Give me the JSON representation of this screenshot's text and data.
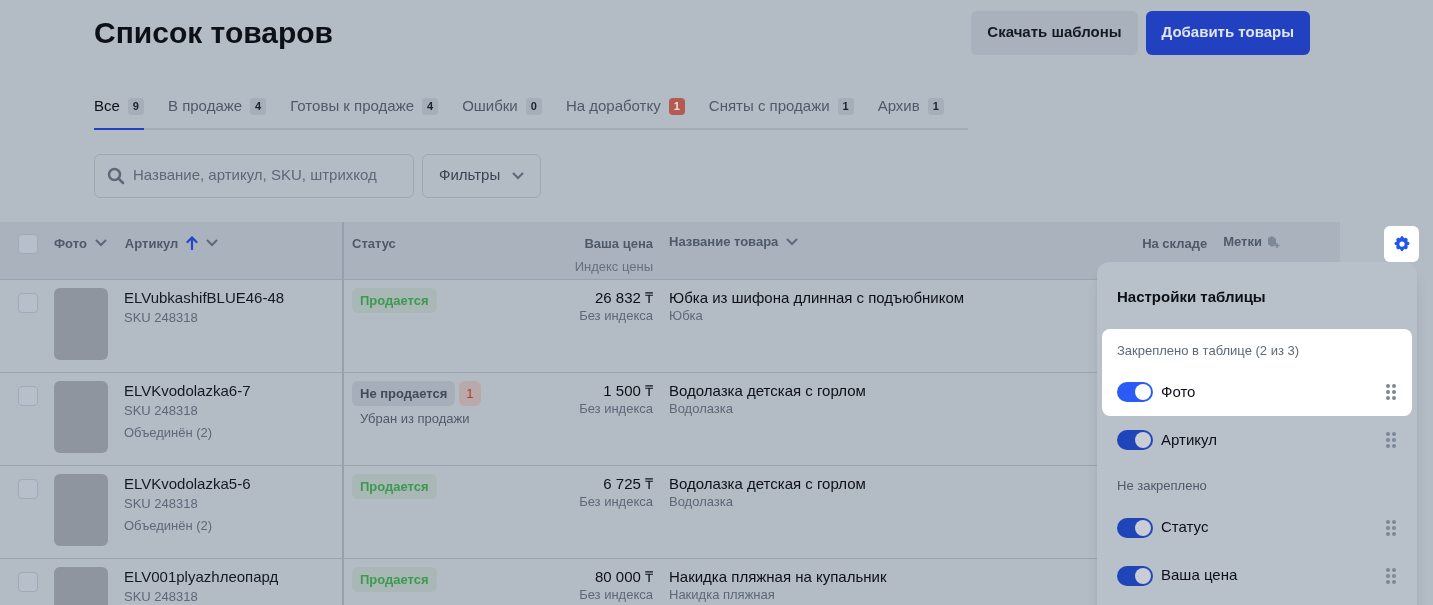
{
  "title": "Список товаров",
  "buttons": [
    {
      "label": "Скачать шаблоны",
      "kind": "secondary"
    },
    {
      "label": "Добавить товары",
      "kind": "primary"
    }
  ],
  "tabs": [
    {
      "label": "Все",
      "count": "9",
      "selected": true,
      "alert": false
    },
    {
      "label": "В продаже",
      "count": "4",
      "selected": false,
      "alert": false
    },
    {
      "label": "Готовы к продаже",
      "count": "4",
      "selected": false,
      "alert": false
    },
    {
      "label": "Ошибки",
      "count": "0",
      "selected": false,
      "alert": false
    },
    {
      "label": "На доработку",
      "count": "1",
      "selected": false,
      "alert": true
    },
    {
      "label": "Сняты с продажи",
      "count": "1",
      "selected": false,
      "alert": false
    },
    {
      "label": "Архив",
      "count": "1",
      "selected": false,
      "alert": false
    }
  ],
  "search": {
    "placeholder": "Название, артикул, SKU, штрихкод"
  },
  "filters": {
    "label": "Фильтры"
  },
  "table": {
    "select_all": {
      "checked": false
    },
    "columns": {
      "photo": "Фото",
      "article": "Артикул",
      "article_sorted": true,
      "status": "Статус",
      "price": "Ваша цена",
      "price_sub": "Индекс цены",
      "name": "Название товара",
      "stock": "На складе",
      "tags": "Метки"
    },
    "rows": [
      {
        "checked": false,
        "article": "ELVubkashifBLUE46-48",
        "sku": "SKU 248318",
        "status": {
          "text": "Продается",
          "kind": "selling"
        },
        "price": "26 832 ₸",
        "price_index": "Без индекса",
        "name": "Юбка из шифона длинная с подъюбником",
        "category": "Юбка"
      },
      {
        "checked": false,
        "article": "ELVKvodolazka6-7",
        "sku": "SKU 248318",
        "merged": "Объединён (2)",
        "status": {
          "text": "Не продается",
          "kind": "not_selling",
          "badge": "1",
          "note": "Убран из продажи"
        },
        "price": "1 500 ₸",
        "price_index": "Без индекса",
        "name": "Водолазка детская с горлом",
        "category": "Водолазка"
      },
      {
        "checked": false,
        "article": "ELVKvodolazka5-6",
        "sku": "SKU 248318",
        "merged": "Объединён (2)",
        "status": {
          "text": "Продается",
          "kind": "selling"
        },
        "price": "6 725 ₸",
        "price_index": "Без индекса",
        "name": "Водолазка детская с горлом",
        "category": "Водолазка"
      },
      {
        "checked": false,
        "article": "ELV001plyazhлеопард",
        "sku": "SKU 248318",
        "status": {
          "text": "Продается",
          "kind": "selling"
        },
        "price": "80 000 ₸",
        "price_index": "Без индекса",
        "name": "Накидка пляжная на купальник",
        "category": "Накидка пляжная"
      }
    ]
  },
  "settings": {
    "gear_highlighted": true,
    "title": "Настройки таблицы",
    "rows": [
      {
        "kind": "heading",
        "text": "Закреплено в таблице (2 из 3)",
        "highlighted": true
      },
      {
        "kind": "toggle",
        "label": "Фото",
        "on": true,
        "highlighted": true
      },
      {
        "kind": "toggle",
        "label": "Артикул",
        "on": true,
        "highlighted": false
      },
      {
        "kind": "heading",
        "text": "Не закреплено",
        "highlighted": false
      },
      {
        "kind": "toggle",
        "label": "Статус",
        "on": true,
        "highlighted": false
      },
      {
        "kind": "toggle",
        "label": "Ваша цена",
        "on": true,
        "highlighted": false
      }
    ]
  }
}
